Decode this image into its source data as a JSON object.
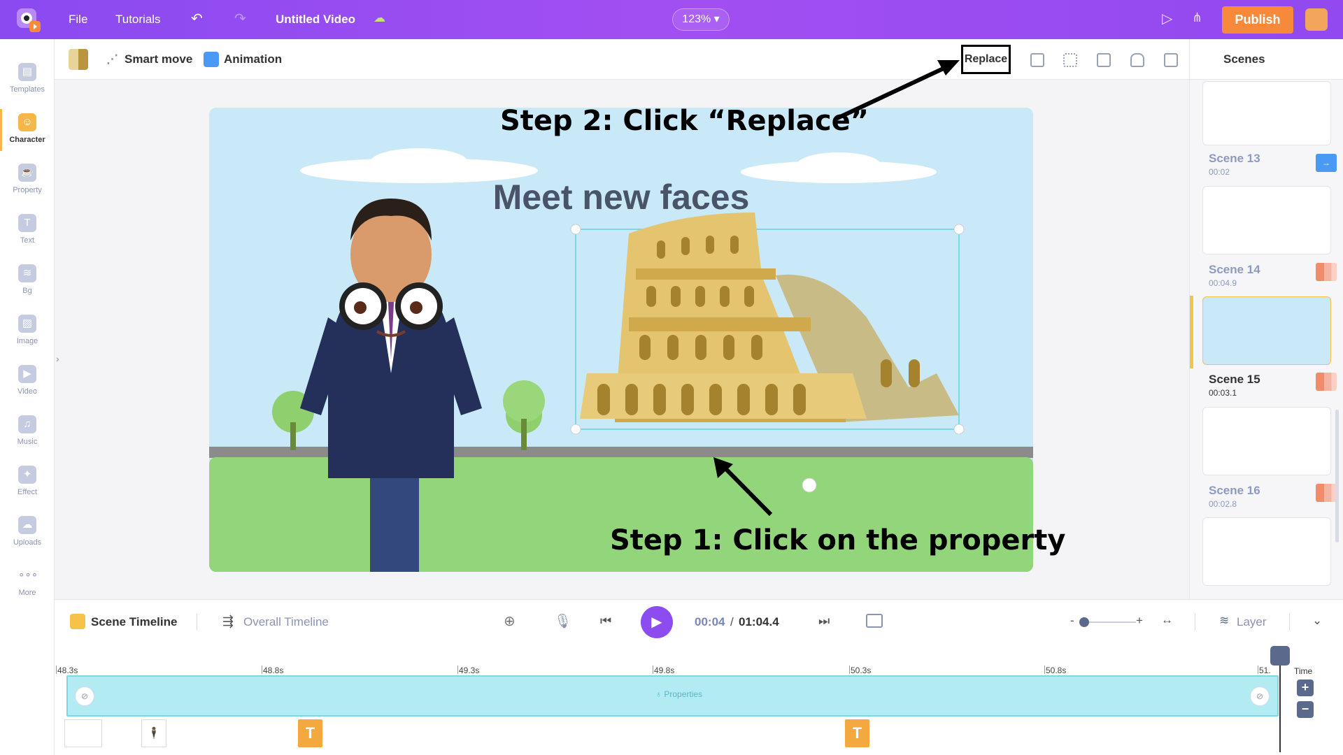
{
  "topbar": {
    "menu_file": "File",
    "menu_tutorials": "Tutorials",
    "title": "Untitled Video",
    "zoom": "123%",
    "publish": "Publish",
    "brand_color": "#9b4cf1",
    "publish_color": "#f7893a",
    "icons": [
      "logo",
      "undo-icon",
      "redo-icon",
      "cloud-saved-icon",
      "preview-play-icon",
      "share-icon",
      "avatar"
    ]
  },
  "sidebar": {
    "items": [
      {
        "label": "Templates",
        "icon": "templates-icon"
      },
      {
        "label": "Character",
        "icon": "character-icon",
        "active": true
      },
      {
        "label": "Property",
        "icon": "property-icon"
      },
      {
        "label": "Text",
        "icon": "text-icon"
      },
      {
        "label": "Bg",
        "icon": "bg-icon"
      },
      {
        "label": "Image",
        "icon": "image-icon"
      },
      {
        "label": "Video",
        "icon": "video-icon"
      },
      {
        "label": "Music",
        "icon": "music-icon"
      },
      {
        "label": "Effect",
        "icon": "effect-icon"
      },
      {
        "label": "Uploads",
        "icon": "uploads-icon"
      },
      {
        "label": "More",
        "icon": "more-icon"
      }
    ]
  },
  "toolbar": {
    "smart_move": "Smart move",
    "animation": "Animation",
    "replace": "Replace",
    "icons": [
      "color-swatch",
      "flip-icon",
      "transparency-icon",
      "align-icon",
      "lock-icon",
      "trash-icon"
    ]
  },
  "canvas": {
    "heading": "Meet new faces"
  },
  "annotations": {
    "step2": "Step 2: Click “Replace”",
    "step1": "Step 1: Click on the property"
  },
  "scenes": {
    "title": "Scenes",
    "items": [
      {
        "name": "Scene 13",
        "time": "00:02"
      },
      {
        "name": "Scene 14",
        "time": "00:04.9"
      },
      {
        "name": "Scene 15",
        "time": "00:03.1",
        "active": true
      },
      {
        "name": "Scene 16",
        "time": "00:02.8"
      }
    ]
  },
  "timeline": {
    "scene_timeline": "Scene Timeline",
    "overall_timeline": "Overall Timeline",
    "current_time": "00:04",
    "total_time": "01:04.4",
    "separator": "/",
    "layer": "Layer",
    "time_label": "Time",
    "track_label": "Properties",
    "ruler": [
      "48.3s",
      "48.8s",
      "49.3s",
      "49.8s",
      "50.3s",
      "50.8s",
      "51."
    ],
    "text_marker": "T",
    "zoom_in": "+",
    "zoom_out": "−",
    "slider_minus": "-",
    "slider_plus": "+"
  }
}
